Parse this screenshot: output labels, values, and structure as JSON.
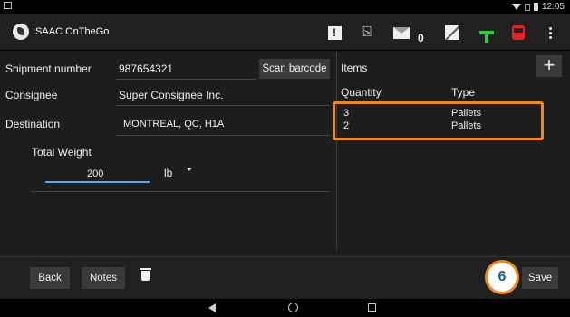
{
  "app": {
    "title": "ISAAC OnTheGo",
    "mail_count": "0"
  },
  "status": {
    "time": "12:05"
  },
  "form": {
    "shipment_label": "Shipment number",
    "shipment_value": "987654321",
    "scan_label": "Scan barcode",
    "consignee_label": "Consignee",
    "consignee_value": "Super Consignee Inc.",
    "destination_label": "Destination",
    "destination_value": "MONTREAL, QC, H1A",
    "total_weight_label": "Total Weight",
    "weight_value": "200",
    "weight_unit": "lb"
  },
  "items": {
    "title": "Items",
    "add_label": "+",
    "columns": [
      "Quantity",
      "Type"
    ],
    "rows": [
      {
        "quantity": "3",
        "type": "Pallets"
      },
      {
        "quantity": "2",
        "type": "Pallets"
      }
    ]
  },
  "bottom": {
    "back": "Back",
    "notes": "Notes",
    "save": "Save"
  },
  "callout": {
    "number": "6"
  },
  "colors": {
    "highlight": "#f28a1a",
    "accent": "#5aa9e6",
    "tower": "#2ecc40",
    "truck": "#e8212b"
  },
  "icons": [
    "alert-icon",
    "person-icon",
    "mail-icon",
    "signature-icon",
    "tower-icon",
    "truck-icon",
    "overflow-menu-icon",
    "trash-icon",
    "nav-back-icon",
    "nav-home-icon",
    "nav-recent-icon"
  ]
}
